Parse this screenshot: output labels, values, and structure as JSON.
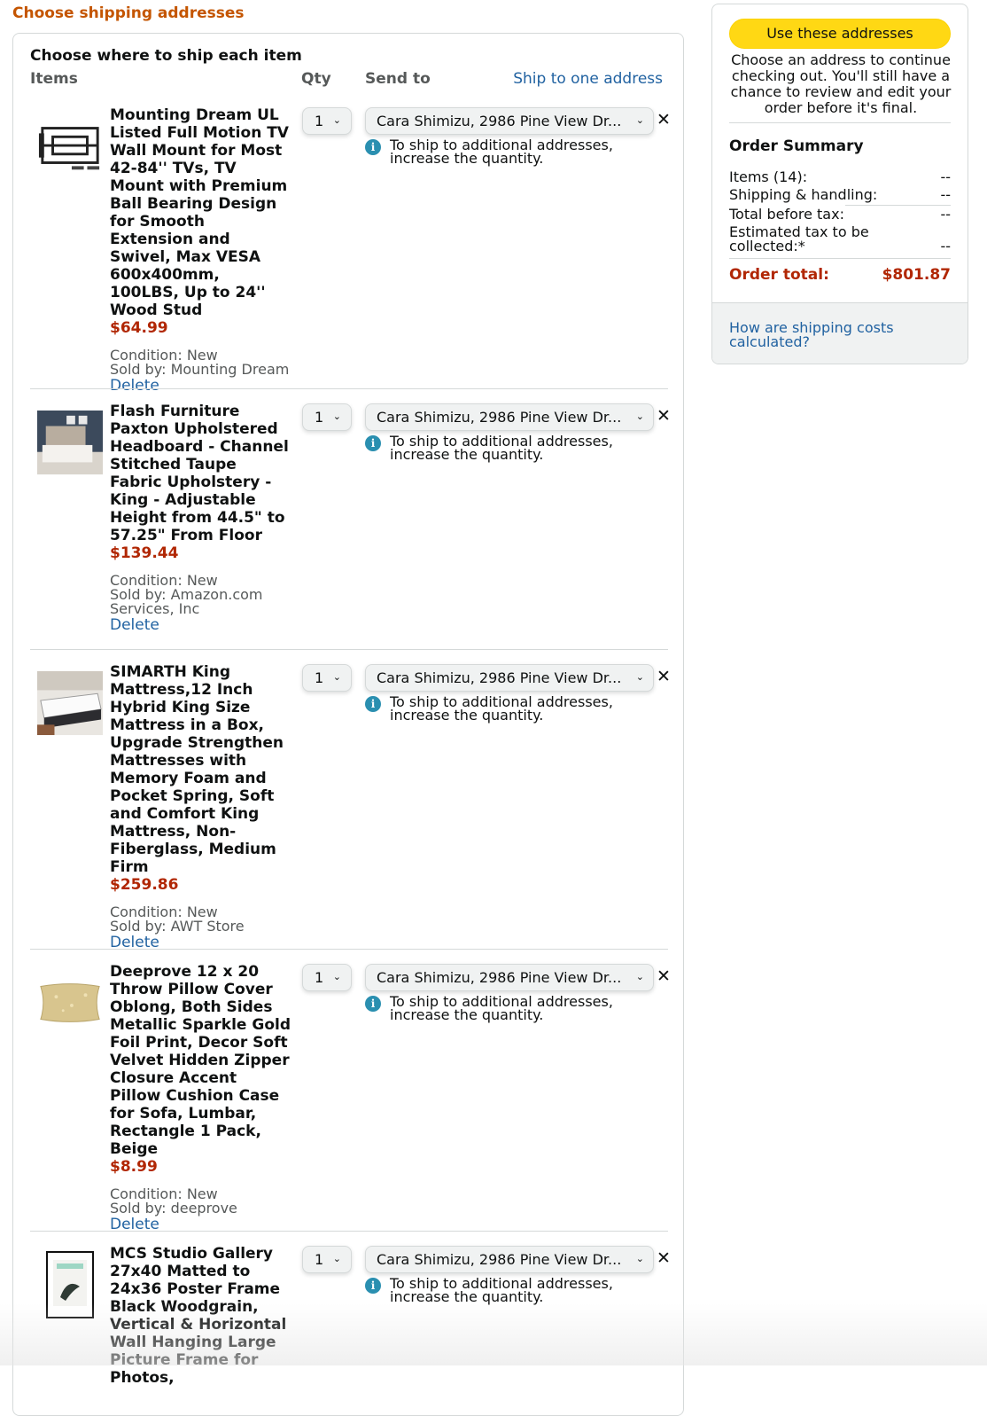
{
  "page": {
    "title": "Choose shipping addresses"
  },
  "main": {
    "heading": "Choose where to ship each item",
    "columns": {
      "items": "Items",
      "qty": "Qty",
      "send_to": "Send to"
    },
    "ship_one_link": "Ship to one address",
    "items": [
      {
        "title": "Mounting Dream UL Listed Full Motion TV Wall Mount for Most 42-84'' TVs, TV Mount with Premium Ball Bearing Design for Smooth Extension and Swivel, Max VESA 600x400mm, 100LBS, Up to 24'' Wood Stud",
        "price": "$64.99",
        "condition": "Condition: New",
        "seller": "Sold by: Mounting Dream",
        "delete": "Delete",
        "qty": "1",
        "address": "Cara Shimizu, 2986 Pine View Dr...",
        "note": "To ship to additional addresses, increase the quantity.",
        "icon": "tv-mount-image"
      },
      {
        "title": "Flash Furniture Paxton Upholstered Headboard - Channel Stitched Taupe Fabric Upholstery - King - Adjustable Height from 44.5\" to 57.25\" From Floor",
        "price": "$139.44",
        "condition": "Condition: New",
        "seller": "Sold by: Amazon.com Services, Inc",
        "delete": "Delete",
        "qty": "1",
        "address": "Cara Shimizu, 2986 Pine View Dr...",
        "note": "To ship to additional addresses, increase the quantity.",
        "icon": "headboard-image"
      },
      {
        "title": "SIMARTH King Mattress,12 Inch Hybrid King Size Mattress in a Box, Upgrade Strengthen Mattresses with Memory Foam and Pocket Spring, Soft and Comfort King Mattress, Non-Fiberglass, Medium Firm",
        "price": "$259.86",
        "condition": "Condition: New",
        "seller": "Sold by: AWT Store",
        "delete": "Delete",
        "qty": "1",
        "address": "Cara Shimizu, 2986 Pine View Dr...",
        "note": "To ship to additional addresses, increase the quantity.",
        "icon": "mattress-image"
      },
      {
        "title": "Deeprove 12 x 20 Throw Pillow Cover Oblong, Both Sides Metallic Sparkle Gold Foil Print, Decor Soft Velvet Hidden Zipper Closure Accent Pillow Cushion Case for Sofa, Lumbar, Rectangle 1 Pack, Beige",
        "price": "$8.99",
        "condition": "Condition: New",
        "seller": "Sold by: deeprove",
        "delete": "Delete",
        "qty": "1",
        "address": "Cara Shimizu, 2986 Pine View Dr...",
        "note": "To ship to additional addresses, increase the quantity.",
        "icon": "pillow-image"
      },
      {
        "title": "MCS Studio Gallery 27x40 Matted to 24x36 Poster Frame Black Woodgrain, Vertical & Horizontal Wall Hanging Large Picture Frame for Photos,",
        "price": "",
        "condition": "",
        "seller": "",
        "delete": "",
        "qty": "1",
        "address": "Cara Shimizu, 2986 Pine View Dr...",
        "note": "To ship to additional addresses, increase the quantity.",
        "icon": "poster-frame-image"
      }
    ]
  },
  "sidebar": {
    "button": "Use these addresses",
    "description": "Choose an address to continue checking out. You'll still have a chance to review and edit your order before it's final.",
    "summary_title": "Order Summary",
    "lines": [
      {
        "label": "Items (14):",
        "amount": "--"
      },
      {
        "label": "Shipping & handling:",
        "amount": "--"
      },
      {
        "label": "Total before tax:",
        "amount": "--"
      },
      {
        "label": "Estimated tax to be collected:*",
        "amount": "--"
      }
    ],
    "total_label": "Order total:",
    "total_amount": "$801.87",
    "shipping_link": "How are shipping costs calculated?"
  },
  "colors": {
    "accent_orange": "#c45500",
    "link_blue": "#2162a1",
    "price_red": "#b12704",
    "button_yellow": "#ffd814"
  }
}
